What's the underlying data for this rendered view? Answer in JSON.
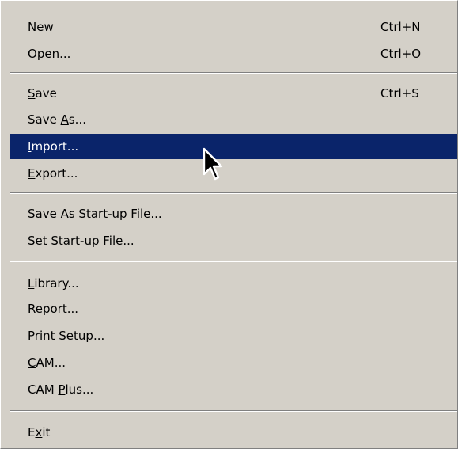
{
  "menu": {
    "items": [
      {
        "pre": "",
        "key": "N",
        "post": "ew",
        "shortcut": "Ctrl+N"
      },
      {
        "pre": "",
        "key": "O",
        "post": "pen...",
        "shortcut": "Ctrl+O"
      },
      {
        "pre": "",
        "key": "S",
        "post": "ave",
        "shortcut": "Ctrl+S"
      },
      {
        "pre": "Save ",
        "key": "A",
        "post": "s...",
        "shortcut": ""
      },
      {
        "pre": "",
        "key": "I",
        "post": "mport...",
        "shortcut": ""
      },
      {
        "pre": "",
        "key": "E",
        "post": "xport...",
        "shortcut": ""
      },
      {
        "pre": "Save As Start-up File...",
        "key": "",
        "post": "",
        "shortcut": ""
      },
      {
        "pre": "Set Start-up File...",
        "key": "",
        "post": "",
        "shortcut": ""
      },
      {
        "pre": "",
        "key": "L",
        "post": "ibrary...",
        "shortcut": ""
      },
      {
        "pre": "",
        "key": "R",
        "post": "eport...",
        "shortcut": ""
      },
      {
        "pre": "Prin",
        "key": "t",
        "post": " Setup...",
        "shortcut": ""
      },
      {
        "pre": "",
        "key": "C",
        "post": "AM...",
        "shortcut": ""
      },
      {
        "pre": "CAM ",
        "key": "P",
        "post": "lus...",
        "shortcut": ""
      },
      {
        "pre": "E",
        "key": "x",
        "post": "it",
        "shortcut": ""
      }
    ],
    "highlighted_item": "Import...",
    "colors": {
      "menu_background": "#d4d0c8",
      "highlight_background": "#0a246a",
      "highlight_text": "#ffffff",
      "text": "#000000"
    }
  },
  "cursor": {
    "icon": "arrow-pointer-icon"
  }
}
